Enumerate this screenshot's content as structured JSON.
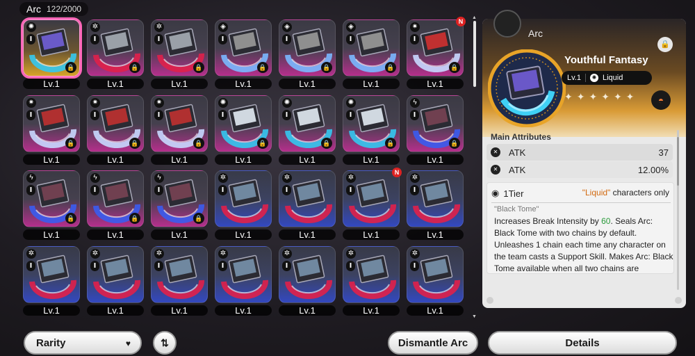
{
  "header": {
    "title": "Arc",
    "count": "122/2000"
  },
  "grid": {
    "cards": [
      {
        "level": "Lv.1",
        "style": "gold",
        "ring": "#34c8f0",
        "tint": "#6a5ac8",
        "selected": true,
        "new": false,
        "elem": "✺",
        "locked": true
      },
      {
        "level": "Lv.1",
        "style": "pink",
        "ring": "#e0204a",
        "tint": "#9aa0a8",
        "selected": false,
        "new": false,
        "elem": "✲",
        "locked": true
      },
      {
        "level": "Lv.1",
        "style": "pink",
        "ring": "#e0204a",
        "tint": "#9aa0a8",
        "selected": false,
        "new": false,
        "elem": "✲",
        "locked": true
      },
      {
        "level": "Lv.1",
        "style": "pink",
        "ring": "#7ab8ff",
        "tint": "#8f8f8f",
        "selected": false,
        "new": false,
        "elem": "◈",
        "locked": true
      },
      {
        "level": "Lv.1",
        "style": "pink",
        "ring": "#7ab8ff",
        "tint": "#8f8f8f",
        "selected": false,
        "new": false,
        "elem": "◈",
        "locked": true
      },
      {
        "level": "Lv.1",
        "style": "pink",
        "ring": "#7ab8ff",
        "tint": "#8f8f8f",
        "selected": false,
        "new": false,
        "elem": "◈",
        "locked": true
      },
      {
        "level": "Lv.1",
        "style": "pink",
        "ring": "#c8d8ff",
        "tint": "#c03030",
        "selected": false,
        "new": true,
        "elem": "✷",
        "locked": true
      },
      {
        "level": "Lv.1",
        "style": "pink",
        "ring": "#c8d8ff",
        "tint": "#b03030",
        "selected": false,
        "new": false,
        "elem": "✷",
        "locked": true
      },
      {
        "level": "Lv.1",
        "style": "pink",
        "ring": "#c8d8ff",
        "tint": "#b03030",
        "selected": false,
        "new": false,
        "elem": "✷",
        "locked": true
      },
      {
        "level": "Lv.1",
        "style": "pink",
        "ring": "#c8d8ff",
        "tint": "#b03030",
        "selected": false,
        "new": false,
        "elem": "✷",
        "locked": true
      },
      {
        "level": "Lv.1",
        "style": "pink",
        "ring": "#34c8f0",
        "tint": "#d0d8e0",
        "selected": false,
        "new": false,
        "elem": "✺",
        "locked": true
      },
      {
        "level": "Lv.1",
        "style": "pink",
        "ring": "#34c8f0",
        "tint": "#d0d8e0",
        "selected": false,
        "new": false,
        "elem": "✺",
        "locked": true
      },
      {
        "level": "Lv.1",
        "style": "pink",
        "ring": "#34c8f0",
        "tint": "#d0d8e0",
        "selected": false,
        "new": false,
        "elem": "✺",
        "locked": true
      },
      {
        "level": "Lv.1",
        "style": "pink",
        "ring": "#3a5cf0",
        "tint": "#704050",
        "selected": false,
        "new": false,
        "elem": "ϟ",
        "locked": true
      },
      {
        "level": "Lv.1",
        "style": "pink",
        "ring": "#3a5cf0",
        "tint": "#704050",
        "selected": false,
        "new": false,
        "elem": "ϟ",
        "locked": true
      },
      {
        "level": "Lv.1",
        "style": "pink",
        "ring": "#3a5cf0",
        "tint": "#704050",
        "selected": false,
        "new": false,
        "elem": "ϟ",
        "locked": true
      },
      {
        "level": "Lv.1",
        "style": "pink",
        "ring": "#3a5cf0",
        "tint": "#704050",
        "selected": false,
        "new": false,
        "elem": "ϟ",
        "locked": true
      },
      {
        "level": "Lv.1",
        "style": "blue",
        "ring": "#e0204a",
        "tint": "#7088a0",
        "selected": false,
        "new": false,
        "elem": "✲",
        "locked": false
      },
      {
        "level": "Lv.1",
        "style": "blue",
        "ring": "#e0204a",
        "tint": "#7088a0",
        "selected": false,
        "new": false,
        "elem": "✲",
        "locked": false
      },
      {
        "level": "Lv.1",
        "style": "blue",
        "ring": "#e0204a",
        "tint": "#7088a0",
        "selected": false,
        "new": true,
        "elem": "✲",
        "locked": false
      },
      {
        "level": "Lv.1",
        "style": "blue",
        "ring": "#e0204a",
        "tint": "#7088a0",
        "selected": false,
        "new": false,
        "elem": "✲",
        "locked": false
      },
      {
        "level": "Lv.1",
        "style": "blue",
        "ring": "#e0204a",
        "tint": "#7088a0",
        "selected": false,
        "new": false,
        "elem": "✲",
        "locked": false
      },
      {
        "level": "Lv.1",
        "style": "blue",
        "ring": "#e0204a",
        "tint": "#7088a0",
        "selected": false,
        "new": false,
        "elem": "✲",
        "locked": false
      },
      {
        "level": "Lv.1",
        "style": "blue",
        "ring": "#e0204a",
        "tint": "#7088a0",
        "selected": false,
        "new": false,
        "elem": "✲",
        "locked": false
      },
      {
        "level": "Lv.1",
        "style": "blue",
        "ring": "#e0204a",
        "tint": "#7088a0",
        "selected": false,
        "new": false,
        "elem": "✲",
        "locked": false
      },
      {
        "level": "Lv.1",
        "style": "blue",
        "ring": "#e0204a",
        "tint": "#7088a0",
        "selected": false,
        "new": false,
        "elem": "✲",
        "locked": false
      },
      {
        "level": "Lv.1",
        "style": "blue",
        "ring": "#e0204a",
        "tint": "#7088a0",
        "selected": false,
        "new": false,
        "elem": "✲",
        "locked": false
      },
      {
        "level": "Lv.1",
        "style": "blue",
        "ring": "#e0204a",
        "tint": "#7088a0",
        "selected": false,
        "new": false,
        "elem": "✲",
        "locked": false
      }
    ],
    "tier_label": "I",
    "new_label": "N"
  },
  "detail": {
    "category": "Arc",
    "name": "Youthful Fantasy",
    "level": "Lv.1",
    "element": "Liquid",
    "main_attributes_title": "Main Attributes",
    "attributes": [
      {
        "name": "ATK",
        "value": "37"
      },
      {
        "name": "ATK",
        "value": "12.00%"
      }
    ],
    "tier": "1Tier",
    "condition_quoted": "\"Liquid\"",
    "condition_rest": " characters only",
    "effect_title": "\"Black Tome\"",
    "effect_pre": "Increases Break Intensity by ",
    "effect_num": "60",
    "effect_post": ". Seals Arc: Black Tome with two chains by default. Unleashes 1 chain each time any character on the team casts a Support Skill. Makes Arc: Black Tome available when all two chains are unleashed."
  },
  "bottom": {
    "rarity_label": "Rarity",
    "dismantle_label": "Dismantle Arc",
    "details_label": "Details"
  },
  "icons": {
    "lock": "lock-icon",
    "caret": "caret-down-icon",
    "sort": "sort-toggle-icon",
    "star": "star-icon"
  }
}
